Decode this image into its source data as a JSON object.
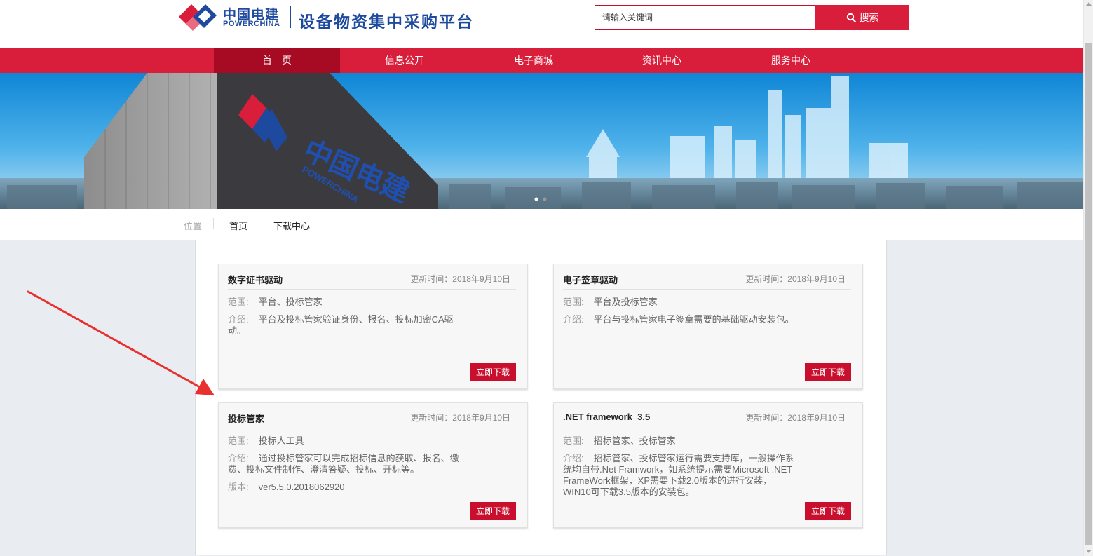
{
  "header": {
    "brand_cn": "中国电建",
    "brand_en": "POWERCHINA",
    "platform_title": "设备物资集中采购平台",
    "search_placeholder": "请输入关键词",
    "search_button": "搜索"
  },
  "nav": {
    "items": [
      "首页",
      "信息公开",
      "电子商城",
      "资讯中心",
      "服务中心"
    ],
    "active_index": 0
  },
  "banner": {
    "building_sign_cn": "中国电建",
    "building_sign_en": "POWERCHINA"
  },
  "breadcrumb": {
    "position_label": "位置",
    "home": "首页",
    "current": "下载中心"
  },
  "downloads": [
    {
      "title": "数字证书驱动",
      "updated": "更新时间：2018年9月10日",
      "scope_label": "范围:",
      "scope": "平台、投标管家",
      "intro_label": "介绍:",
      "intro_line1": "平台及投标管家验证身份、报名、投标加密CA驱",
      "intro_line2": "动。",
      "button": "立即下载"
    },
    {
      "title": "电子签章驱动",
      "updated": "更新时间：2018年9月10日",
      "scope_label": "范围:",
      "scope": "平台及投标管家",
      "intro_label": "介绍:",
      "intro_line1": "平台与投标管家电子签章需要的基础驱动安装包。",
      "button": "立即下载"
    },
    {
      "title": "投标管家",
      "updated": "更新时间：2018年9月10日",
      "scope_label": "范围:",
      "scope": "投标人工具",
      "intro_label": "介绍:",
      "intro_line1": "通过投标管家可以完成招标信息的获取、报名、缴",
      "intro_line2": "费、投标文件制作、澄清答疑、投标、开标等。",
      "version_label": "版本:",
      "version": "ver5.5.0.2018062920",
      "button": "立即下载"
    },
    {
      "title": ".NET framework_3.5",
      "updated": "更新时间：2018年9月10日",
      "scope_label": "范围:",
      "scope": "招标管家、投标管家",
      "intro_label": "介绍:",
      "intro_line1": "招标管家、投标管家运行需要支持库，一般操作系",
      "intro_line2": "统均自带.Net Framwork，如系统提示需要Microsoft .NET",
      "intro_line3": "FrameWork框架，XP需要下载2.0版本的进行安装，",
      "intro_line4": "WIN10可下载3.5版本的安装包。",
      "button": "立即下载"
    }
  ],
  "colors": {
    "brand_red": "#d81e3a",
    "nav_active": "#a70b23",
    "brand_blue": "#1d4a9f",
    "button_red": "#c8102e",
    "annotation_arrow": "#e8302f"
  }
}
